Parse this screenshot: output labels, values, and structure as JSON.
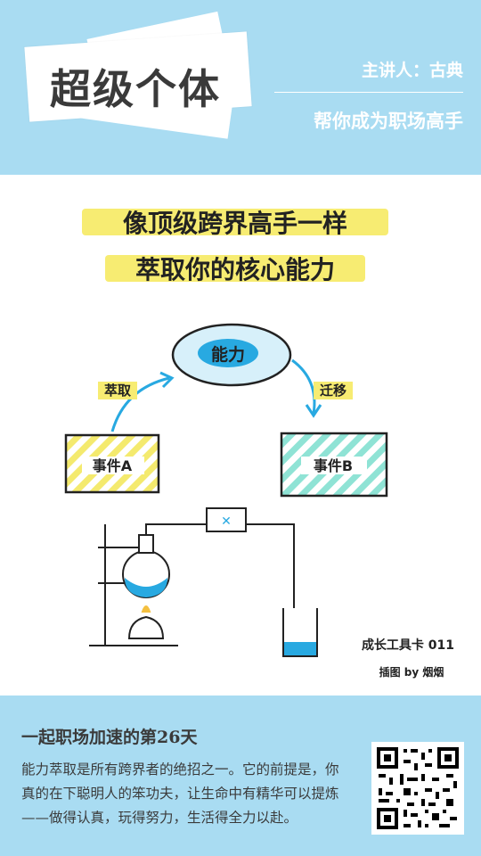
{
  "header": {
    "brand": "超级个体",
    "speaker": "主讲人：古典",
    "tagline": "帮你成为职场高手"
  },
  "card": {
    "title_line1": "像顶级跨界高手一样",
    "title_line2": "萃取你的核心能力",
    "center_label": "能力",
    "left_arrow_label": "萃取",
    "right_arrow_label": "迁移",
    "box_a": "事件A",
    "box_b": "事件B",
    "card_id": "成长工具卡 011",
    "credit": "插图 by 烟烟",
    "colors": {
      "yellow": "#f4ea6e",
      "teal": "#8fe3d5",
      "blue": "#28a9e1",
      "bg": "#a9dcf2"
    }
  },
  "footer": {
    "day_title": "一起职场加速的第26天",
    "description": "能力萃取是所有跨界者的绝招之一。它的前提是，你真的在下聪明人的笨功夫，让生命中有精华可以提炼——做得认真，玩得努力，生活得全力以赴。",
    "qr_icon": "qr-code-icon"
  }
}
